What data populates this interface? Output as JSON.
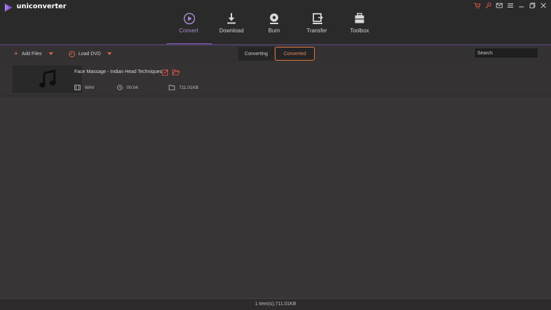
{
  "app": {
    "name": "uniconverter"
  },
  "window_icons": [
    "cart-icon",
    "key-icon",
    "mail-icon",
    "menu-icon",
    "minimize-icon",
    "maximize-icon",
    "close-icon"
  ],
  "nav": {
    "items": [
      {
        "label": "Convert",
        "icon": "convert-icon",
        "active": true
      },
      {
        "label": "Download",
        "icon": "download-icon",
        "active": false
      },
      {
        "label": "Burn",
        "icon": "burn-icon",
        "active": false
      },
      {
        "label": "Transfer",
        "icon": "transfer-icon",
        "active": false
      },
      {
        "label": "Toolbox",
        "icon": "toolbox-icon",
        "active": false
      }
    ]
  },
  "toolbar": {
    "add_files": "Add Files",
    "load_dvd": "Load DVD",
    "tab_converting": "Converting",
    "tab_converted": "Converted",
    "active_tab": "Converted",
    "search_placeholder": "Search"
  },
  "files": [
    {
      "title": "Face Massage - Indian Head Techniques",
      "format": "WAV",
      "duration": "00:04",
      "size": "711.01KB"
    }
  ],
  "status": {
    "summary": "1 Item(s),711.01KB"
  },
  "colors": {
    "accent_purple": "#8c62c4",
    "accent_orange": "#e07a3a",
    "background": "#383536"
  }
}
